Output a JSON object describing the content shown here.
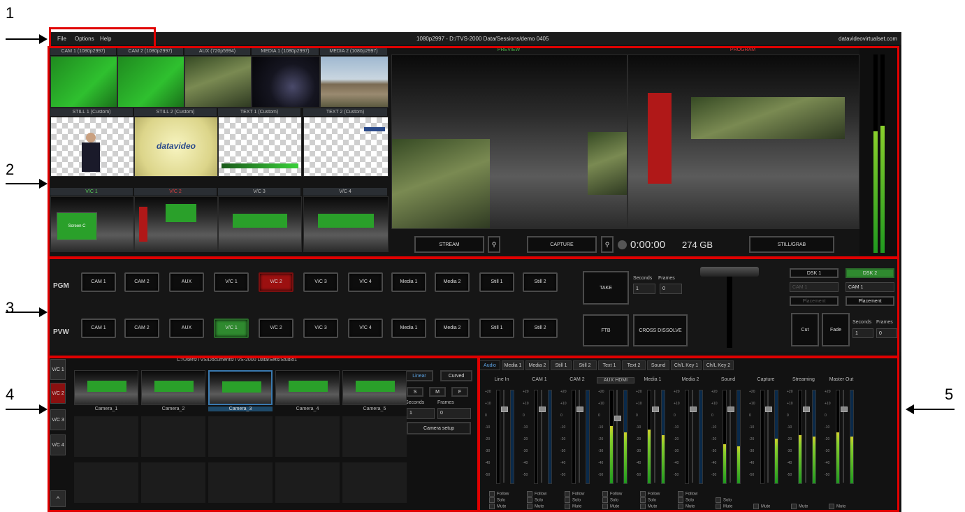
{
  "callouts": [
    "1",
    "2",
    "3",
    "4",
    "5"
  ],
  "menu": {
    "file": "File",
    "options": "Options",
    "help": "Help",
    "title": "1080p2997 - D:/TVS-2000 Data/Sessions/demo 0405",
    "site": "datavideovirtualset.com"
  },
  "sources": {
    "row1": [
      "CAM 1 (1080p2997)",
      "CAM 2 (1080p2997)",
      "AUX (720p5994)",
      "MEDIA 1 (1080p2997)",
      "MEDIA 2 (1080p2997)"
    ],
    "row2": [
      "STILL 1 (Custom)",
      "STILL 2 (Custom)",
      "TEXT 1 (Custom)",
      "TEXT 2 (Custom)"
    ],
    "row3": [
      "V/C 1",
      "V/C 2",
      "V/C 3",
      "V/C 4"
    ],
    "screen_label": "Screen C",
    "logo_text": "datavideo"
  },
  "monitors": {
    "preview": "PREVIEW",
    "program": "PROGRAM"
  },
  "transport": {
    "stream": "STREAM",
    "capture": "CAPTURE",
    "timer": "0:00:00",
    "disk": "274 GB",
    "still": "STILL/GRAB"
  },
  "switcher": {
    "pgm_label": "PGM",
    "pvw_label": "PVW",
    "buttons": [
      "CAM 1",
      "CAM 2",
      "AUX",
      "V/C 1",
      "V/C 2",
      "V/C 3",
      "V/C 4",
      "Media 1",
      "Media 2",
      "Still 1",
      "Still 2"
    ],
    "take": "TAKE",
    "ftb": "FTB",
    "cross": "CROSS DISSOLVE",
    "seconds": "Seconds",
    "frames": "Frames",
    "sec_val": "1",
    "frm_val": "0",
    "dsk1": "DSK 1",
    "dsk2": "DSK 2",
    "dsk_src1": "CAM 1",
    "dsk_src2": "CAM 1",
    "placement": "Placement",
    "cut": "Cut",
    "fade": "Fade"
  },
  "camera_panel": {
    "path": "C:/Users/TVS/Documents/TVS-2000 Data/Sets/Studio1",
    "vc": [
      "V/C 1",
      "V/C 2",
      "V/C 3",
      "V/C 4"
    ],
    "cams": [
      "Camera_1",
      "Camera_2",
      "Camera_3",
      "Camera_4",
      "Camera_5"
    ],
    "linear": "Linear",
    "curved": "Curved",
    "s": "S",
    "m": "M",
    "f": "F",
    "seconds": "Seconds",
    "frames": "Frames",
    "sec_val": "1",
    "frm_val": "0",
    "setup": "Camera setup",
    "up": "^"
  },
  "audio": {
    "tabs": [
      "Audio",
      "Media 1",
      "Media 2",
      "Still 1",
      "Still 2",
      "Text 1",
      "Text 2",
      "Sound",
      "Ch/L Key 1",
      "Ch/L Key 2"
    ],
    "channels": [
      "Line In",
      "CAM 1",
      "CAM 2",
      "AUX HDMI",
      "Media 1",
      "Media 2",
      "Sound",
      "Capture",
      "Streaming",
      "Master Out"
    ],
    "follow": "Follow",
    "solo": "Solo",
    "mute": "Mute",
    "ticks": [
      "+20",
      "+10",
      "0",
      "-10",
      "-20",
      "-30",
      "-40",
      "-50"
    ]
  }
}
